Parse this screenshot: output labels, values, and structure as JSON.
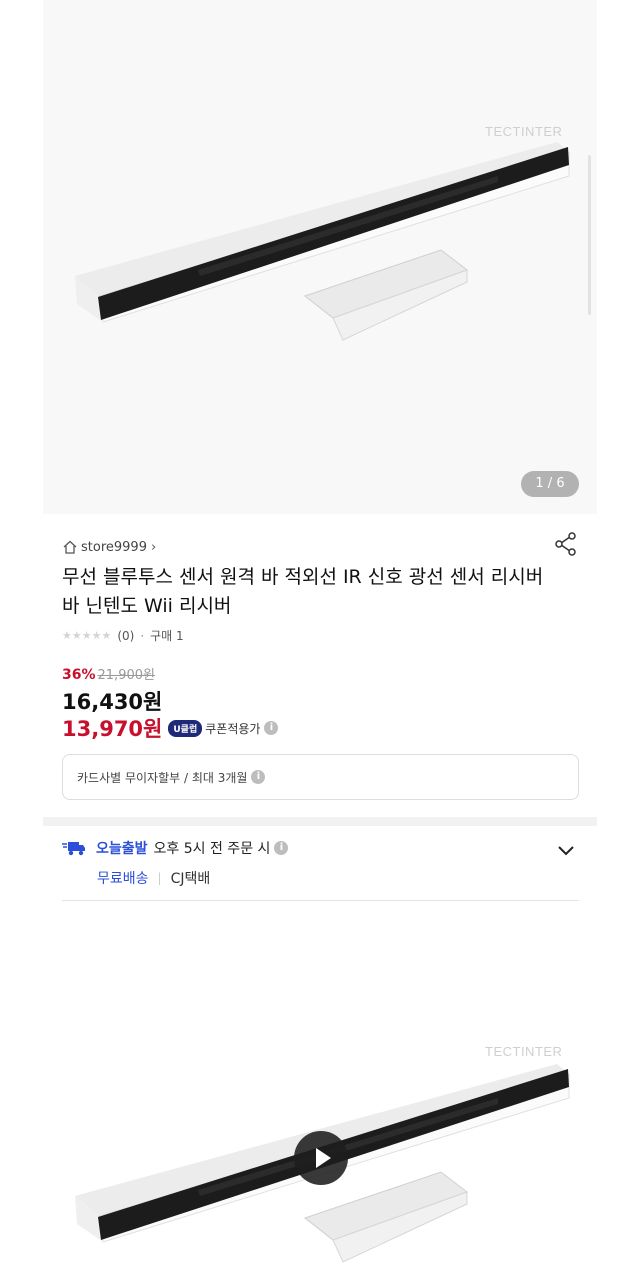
{
  "gallery": {
    "watermark": "TECTINTER",
    "counter": "1 / 6"
  },
  "product": {
    "store_name": "store9999",
    "title": "무선 블루투스 센서 원격 바 적외선 IR 신호 광선 센서 리시버 바 닌텐도 Wii 리시버",
    "review_count": "(0)",
    "purchase_count": "구매 1",
    "discount_percent": "36%",
    "original_price": "21,900원",
    "sale_price": "16,430원",
    "coupon_price": "13,970원",
    "coupon_badge": "U클럽",
    "coupon_label": "쿠폰적용가",
    "installment_text": "카드사별 무이자할부 / 최대 3개월"
  },
  "shipping": {
    "today_label": "오늘출발",
    "cutoff_text": "오후 5시 전 주문 시",
    "free_shipping": "무료배송",
    "carrier": "CJ택배"
  },
  "video": {
    "watermark": "TECTINTER"
  },
  "colors": {
    "discount_red": "#c8102e",
    "shipping_blue": "#2b4fd8"
  }
}
